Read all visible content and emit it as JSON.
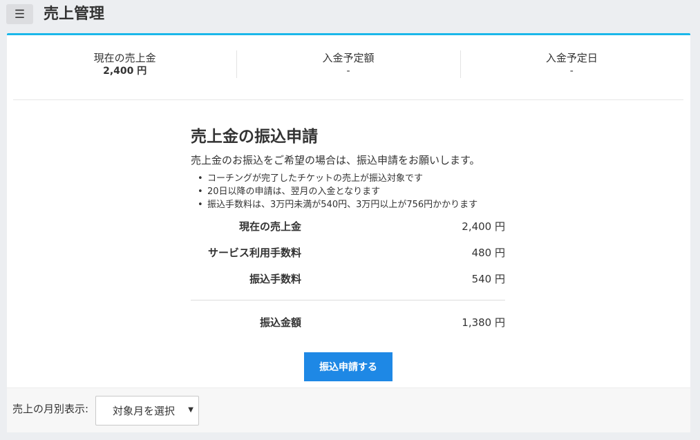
{
  "header": {
    "menu_icon": "☰",
    "title": "売上管理"
  },
  "summary": [
    {
      "label": "現在の売上金",
      "value": "2,400 円"
    },
    {
      "label": "入金予定額",
      "value": "-"
    },
    {
      "label": "入金予定日",
      "value": "-"
    }
  ],
  "transfer": {
    "title": "売上金の振込申請",
    "description": "売上金のお振込をご希望の場合は、振込申請をお願いします。",
    "notes": [
      "コーチングが完了したチケットの売上が振込対象です",
      "20日以降の申請は、翌月の入金となります",
      "振込手数料は、3万円未満が540円、3万円以上が756円かかります"
    ],
    "rows": [
      {
        "label": "現在の売上金",
        "value": "2,400 円"
      },
      {
        "label": "サービス利用手数料",
        "value": "480 円"
      },
      {
        "label": "振込手数料",
        "value": "540 円"
      }
    ],
    "total": {
      "label": "振込金額",
      "value": "1,380 円"
    },
    "apply_label": "振込申請する"
  },
  "footer": {
    "monthly_label": "売上の月別表示:",
    "select_value": "対象月を選択",
    "caret_icon": "▼"
  },
  "colors": {
    "accent_border": "#1ab7ea",
    "primary_button": "#1e88e5",
    "background": "#eceef1"
  }
}
